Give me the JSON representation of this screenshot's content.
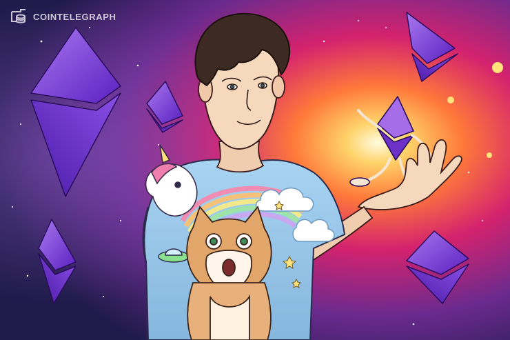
{
  "watermark": {
    "brand": "COINTELEGRAPH"
  },
  "icons": {
    "logo": "cointelegraph-logo-icon",
    "ethereum": "ethereum-diamond-icon"
  },
  "colors": {
    "background_dark": "#1a0f3a",
    "background_magenta": "#c8266f",
    "glow": "#fff2b0",
    "ethereum_purple": "#7b3fe0",
    "shirt_blue": "#9ec9ea"
  }
}
